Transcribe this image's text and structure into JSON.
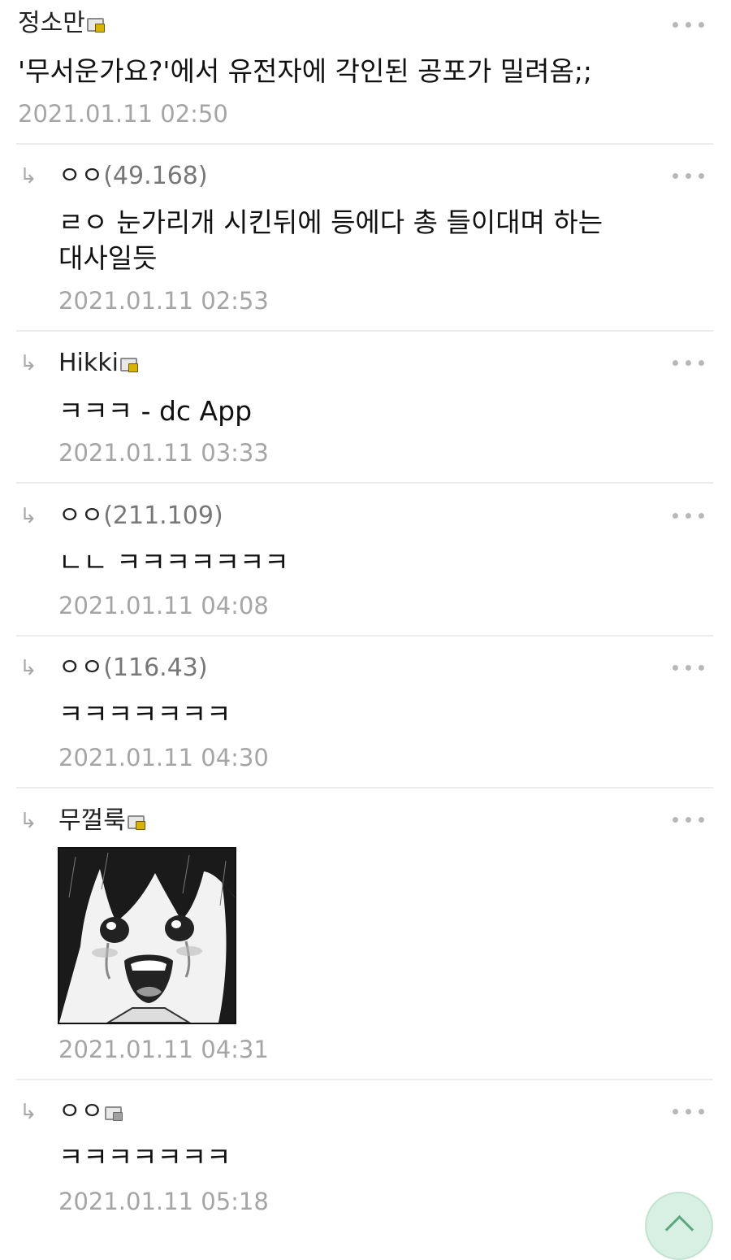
{
  "comments": [
    {
      "name": "정소만",
      "ip": "",
      "text": "'무서운가요?'에서 유전자에 각인된 공포가 밀려옴;;",
      "timestamp": "2021.01.11 02:50"
    },
    {
      "name": "ㅇㅇ",
      "ip": "(49.168)",
      "text_line1": "ㄹㅇ 눈가리개 시킨뒤에 등에다 총 들이대며 하는",
      "text_line2": "대사일듯",
      "timestamp": "2021.01.11 02:53"
    },
    {
      "name": "Hikki",
      "ip": "",
      "text": "ㅋㅋㅋ - dc App",
      "timestamp": "2021.01.11 03:33"
    },
    {
      "name": "ㅇㅇ",
      "ip": "(211.109)",
      "text": "ㄴㄴ ㅋㅋㅋㅋㅋㅋㅋ",
      "timestamp": "2021.01.11 04:08"
    },
    {
      "name": "ㅇㅇ",
      "ip": "(116.43)",
      "text": "ㅋㅋㅋㅋㅋㅋㅋ",
      "timestamp": "2021.01.11 04:30"
    },
    {
      "name": "무껄룩",
      "ip": "",
      "image_alt": "crying anime girl dccon",
      "timestamp": "2021.01.11 04:31"
    },
    {
      "name": "ㅇㅇ",
      "ip": "",
      "text": "ㅋㅋㅋㅋㅋㅋㅋ",
      "timestamp": "2021.01.11 05:18"
    }
  ],
  "icons": {
    "reply": "↳",
    "more": "more-options-icon",
    "badge": "gallery-member-badge-icon",
    "scroll_top": "scroll-to-top-icon"
  },
  "colors": {
    "accent": "#d8efe3",
    "timestamp": "#a5a5a5",
    "divider": "#ececec"
  }
}
